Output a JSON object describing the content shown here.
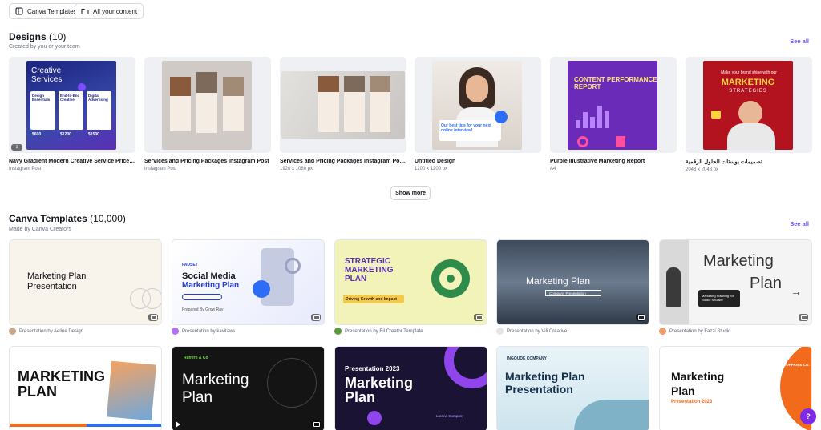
{
  "top_chips": {
    "templates": "Canva Templates",
    "content": "All your content"
  },
  "designs": {
    "title": "Designs",
    "count": "(10)",
    "subtitle": "Created by you or your team",
    "see_all": "See all",
    "show_more": "Show more",
    "items": [
      {
        "title": "Navy Gradient Modern Creative Service Price Li...",
        "meta": "Instagram Post",
        "badge": "1"
      },
      {
        "title": "Services and Pricing Packages Instagram Post",
        "meta": "Instagram Post"
      },
      {
        "title": "Services and Pricing Packages Instagram Post (...",
        "meta": "1920 x 1080 px"
      },
      {
        "title": "Untitled Design",
        "meta": "1200 x 1200 px"
      },
      {
        "title": "Purple Illustrative Marketing Report",
        "meta": "A4"
      },
      {
        "title": "تصميمات بوستات الحلول الرقمية",
        "meta": "2048 x 2048 px"
      }
    ],
    "thumb_text": {
      "creative": "Creative",
      "services": "Services",
      "col1": "Design Essentials",
      "col2": "End-to-End Creative",
      "col3": "Digital Advertising",
      "p1": "$600",
      "p2": "$1200",
      "p3": "$1500",
      "tips": "Our best tips for your next online interview!",
      "report_top": "CONTENT PERFORMANCE",
      "report_bottom": "REPORT",
      "mk_top": "Make your brand shine with our",
      "mk_big": "MARKETING",
      "mk_small": "STRATEGIES"
    }
  },
  "templates": {
    "title": "Canva Templates",
    "count": "(10,000)",
    "subtitle": "Made by Canva Creators",
    "see_all": "See all",
    "items": [
      {
        "author": "Presentation by Aeline Design",
        "t1": "Marketing Plan",
        "t2": "Presentation"
      },
      {
        "author": "Presentation by kavitaws",
        "t1": "Social Media",
        "t2": "Marketing Plan",
        "tag": "FAUSET",
        "sub": "Prepared By Grow Ray"
      },
      {
        "author": "Presentation by Bil Creator Template",
        "t1": "STRATEGIC",
        "t2": "MARKETING",
        "t3": "PLAN",
        "sub": "Driving Growth and Impact"
      },
      {
        "author": "Presentation by Vili Creative",
        "t1": "Marketing Plan",
        "sub": "Company Presentation"
      },
      {
        "author": "Presentation by Fazzi Studio",
        "t1": "Marketing",
        "t2": "Plan",
        "sub": "Marketing Planning for Studio Shodwe"
      },
      {
        "author": "",
        "t1": "MARKETING",
        "t2": "PLAN"
      },
      {
        "author": "",
        "t1": "Marketing",
        "t2": "Plan",
        "tag": "Rafferti & Co"
      },
      {
        "author": "",
        "t1": "Presentation 2023",
        "t2": "Marketing",
        "t3": "Plan",
        "sub": "Larana Company"
      },
      {
        "author": "",
        "t1": "Marketing Plan",
        "t2": "Presentation",
        "tag": "INGOUDE COMPANY"
      },
      {
        "author": "",
        "t1": "Marketing",
        "t2": "Plan",
        "t3": "Presentation 2023",
        "tag": "KOPPAN & CO."
      }
    ]
  },
  "help": "?",
  "colors": {
    "accent": "#6a4ee6",
    "help": "#7d2ae8",
    "navy": "#1b1f6b",
    "purple": "#6a2bb8",
    "orange": "#f26a1b",
    "yellow_green": "#f1f3b8"
  }
}
